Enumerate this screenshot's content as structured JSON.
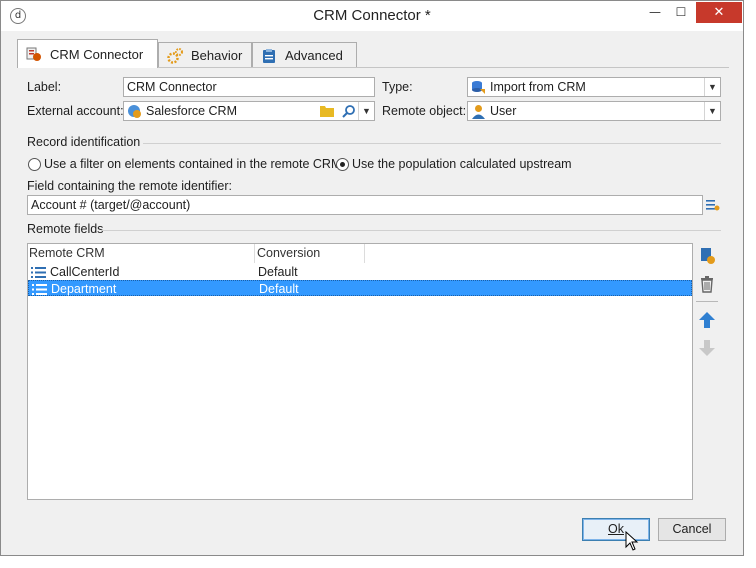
{
  "window": {
    "title": "CRM Connector *"
  },
  "tabs": [
    {
      "label": "CRM Connector",
      "icon": "crm-connector-icon",
      "active": true
    },
    {
      "label": "Behavior",
      "icon": "gears-icon",
      "active": false
    },
    {
      "label": "Advanced",
      "icon": "clipboard-icon",
      "active": false
    }
  ],
  "form": {
    "label_caption": "Label:",
    "label_value": "CRM Connector",
    "type_caption": "Type:",
    "type_value": "Import from CRM",
    "external_account_caption": "External account:",
    "external_account_value": "Salesforce CRM",
    "remote_object_caption": "Remote object:",
    "remote_object_value": "User"
  },
  "record_identification": {
    "title": "Record identification",
    "option1": "Use a filter on elements contained in the remote CRM",
    "option2": "Use the population calculated upstream",
    "selected": "option2",
    "field_caption": "Field containing the remote identifier:",
    "field_value": "Account # (target/@account)"
  },
  "remote_fields": {
    "title": "Remote fields",
    "columns": [
      "Remote CRM",
      "Conversion"
    ],
    "rows": [
      {
        "remote": "CallCenterId",
        "conversion": "Default",
        "selected": false
      },
      {
        "remote": "Department",
        "conversion": "Default",
        "selected": true
      }
    ]
  },
  "buttons": {
    "ok": "Ok",
    "cancel": "Cancel"
  },
  "colors": {
    "selection": "#3399ff",
    "close_button": "#c7392b",
    "accent_blue": "#2f7fd1"
  }
}
